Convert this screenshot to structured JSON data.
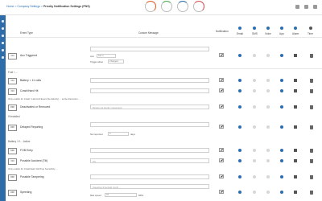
{
  "header": {
    "breadcrumb_link1": "Home",
    "breadcrumb_link2": "Company Settings",
    "breadcrumb_current": "Priority Notification Settings (PNS)"
  },
  "columns": {
    "event_type": "Event Type",
    "custom_message": "Custom Message",
    "notification": "Notifica­tion",
    "email": "Email",
    "sms": "SMS",
    "voice": "Voice",
    "app": "App",
    "alarm": "Alarm",
    "time": "Time"
  },
  "rows": {
    "aux": {
      "toggle": "ON",
      "label": "Aux Triggered",
      "aux_label": "Aux",
      "aux_value": "Aux 1",
      "trigger_label": "Trigger when",
      "trigger_value": "Changed"
    },
    "section1": "Fuel / ...",
    "battery": {
      "toggle": "ON",
      "label": "Battery < 11 volts"
    },
    "crash": {
      "toggle": "ON",
      "label": "Crash/Hard Hit"
    },
    "note1": "Only enable for Crash / Hard Hit Event (Sensitivity) ... at the discretion ...",
    "deactivated": {
      "toggle": "OFF",
      "label": "Deactivated or Removed",
      "placeholder": "Device not found / movement"
    },
    "section2": "If Installed",
    "delayed": {
      "toggle": "OFF",
      "label": "Delayed Reporting",
      "not_reported": "Not reported",
      "value": "3",
      "unit": "days"
    },
    "section3": "Battery / If ... Active",
    "fob": {
      "toggle": "OFF",
      "label": "FOB Entry"
    },
    "possible_accident": {
      "toggle": "ON",
      "label": "Possible Accident (Tilt)",
      "value": "Tilt"
    },
    "note2": "Only enable for Crash/Hard Hit Drop Sensitivity ...",
    "tamper": {
      "toggle": "OFF",
      "label": "Possible Tampering"
    },
    "speeding": {
      "toggle": "OFF",
      "label": "Speeding",
      "value": "Speeding threshold (mph) ...",
      "max_speed": "Max speed",
      "max_value": "70",
      "unit": "MPH"
    }
  }
}
